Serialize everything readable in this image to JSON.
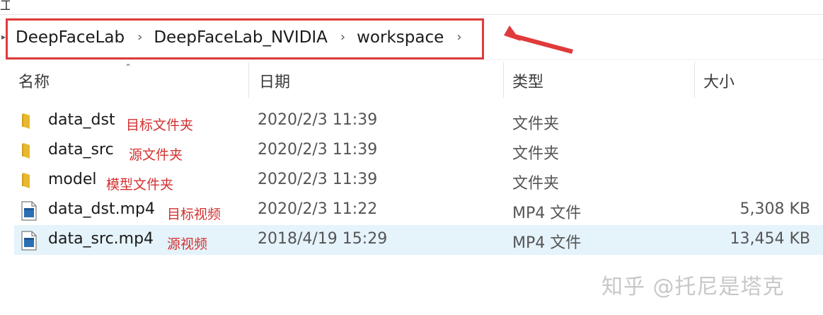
{
  "top": {
    "partial_label": "工具"
  },
  "breadcrumb": {
    "items": [
      "DeepFaceLab",
      "DeepFaceLab_NVIDIA",
      "workspace"
    ]
  },
  "columns": {
    "name": "名称",
    "date": "日期",
    "type": "类型",
    "size": "大小"
  },
  "files": [
    {
      "name": "data_dst",
      "note": "目标文件夹",
      "date": "2020/2/3 11:39",
      "type": "文件夹",
      "size": "",
      "kind": "folder"
    },
    {
      "name": "data_src",
      "note": "源文件夹",
      "date": "2020/2/3 11:39",
      "type": "文件夹",
      "size": "",
      "kind": "folder"
    },
    {
      "name": "model",
      "note": "模型文件夹",
      "date": "2020/2/3 11:39",
      "type": "文件夹",
      "size": "",
      "kind": "folder"
    },
    {
      "name": "data_dst.mp4",
      "note": "目标视频",
      "date": "2020/2/3 11:22",
      "type": "MP4 文件",
      "size": "5,308 KB",
      "kind": "video"
    },
    {
      "name": "data_src.mp4",
      "note": "源视频",
      "date": "2018/4/19 15:29",
      "type": "MP4 文件",
      "size": "13,454 KB",
      "kind": "video",
      "selected": true
    }
  ],
  "watermark": "知乎 @托尼是塔克",
  "colors": {
    "annotation": "#e03a3a",
    "selection": "#e5f3fb",
    "folder": "#e8b92e"
  },
  "icons": {
    "folder": "folder-icon",
    "video": "video-file-icon",
    "chevron": "chevron-right-icon"
  }
}
